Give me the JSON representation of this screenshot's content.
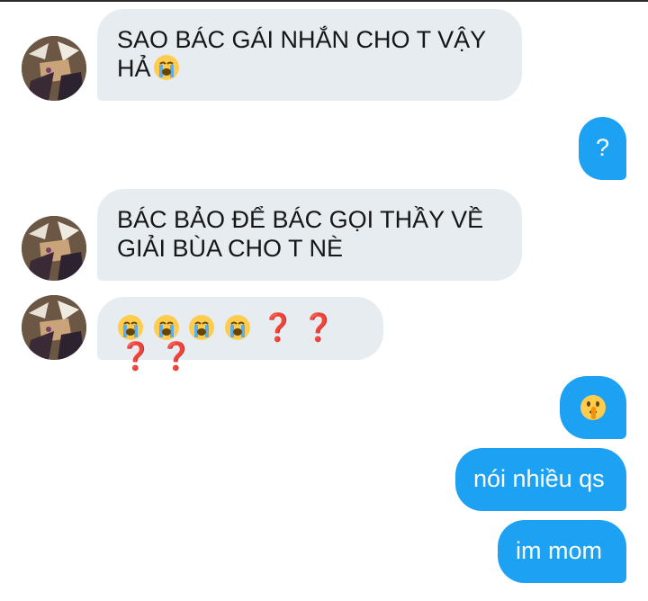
{
  "messages": [
    {
      "side": "in",
      "text": "SAO BÁC GÁI NHẮN CHO T VẬY HẢ",
      "emoji": "loudly-crying-face"
    },
    {
      "side": "out",
      "text": "?"
    },
    {
      "side": "in",
      "text": "BÁC BẢO ĐỂ BÁC GỌI THẦY VỀ GIẢI BÙA CHO T NÈ"
    },
    {
      "side": "in",
      "emojis": [
        "loudly-crying-face",
        "loudly-crying-face",
        "loudly-crying-face",
        "loudly-crying-face"
      ],
      "question_marks": [
        "❓",
        "❓",
        "❓",
        "❓"
      ]
    },
    {
      "side": "out",
      "emoji": "shushing-face"
    },
    {
      "side": "out",
      "text": "nói nhiều qs"
    },
    {
      "side": "out",
      "text": "im mom"
    }
  ],
  "colors": {
    "incoming_bubble": "#e6ecf0",
    "outgoing_bubble": "#1da1f2",
    "question_mark": "#dd2e44"
  }
}
